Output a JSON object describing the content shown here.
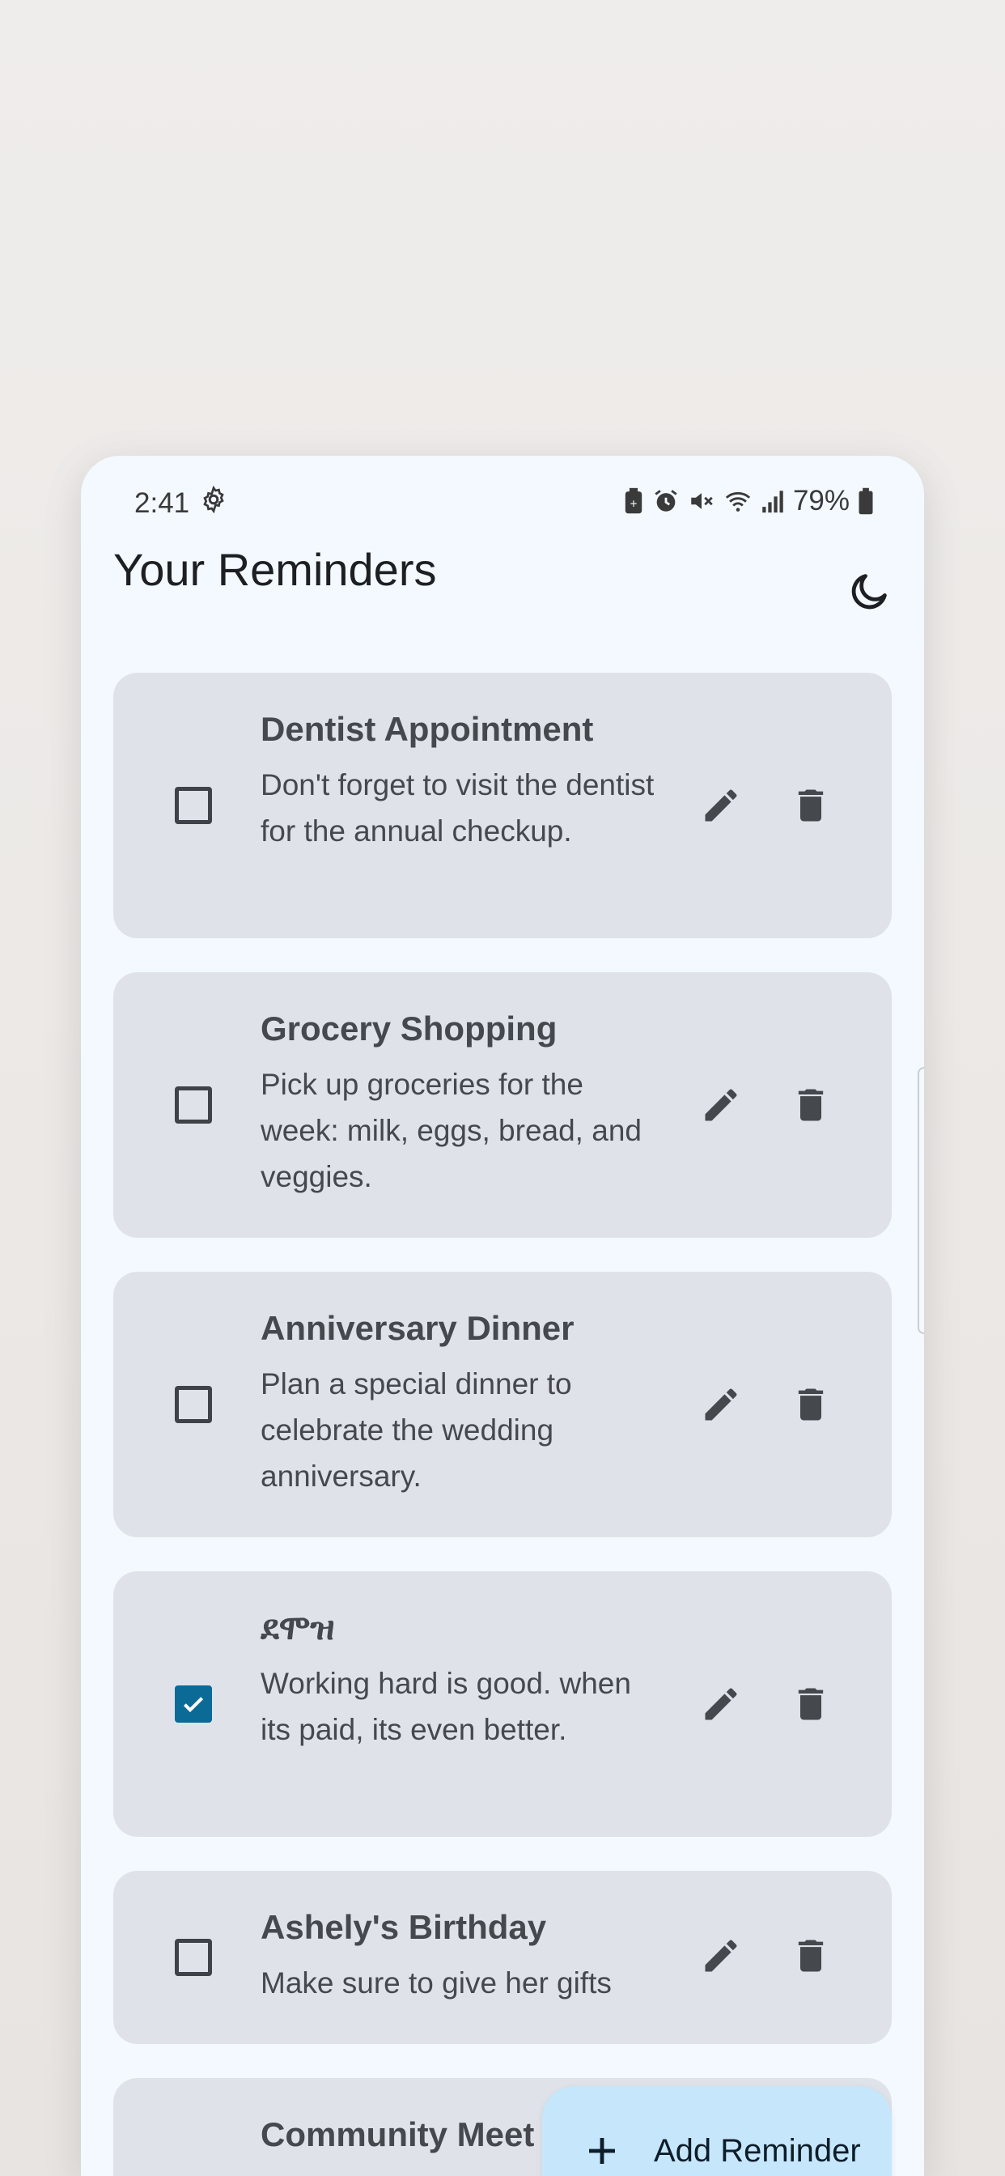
{
  "status_bar": {
    "time": "2:41",
    "battery": "79%",
    "icons": [
      "settings-icon",
      "battery-saver-icon",
      "alarm-icon",
      "mute-icon",
      "wifi-icon",
      "signal-icon",
      "battery-icon"
    ]
  },
  "header": {
    "title": "Your Reminders",
    "theme_toggle_icon": "moon-icon"
  },
  "reminders": [
    {
      "title": "Dentist Appointment",
      "description": "Don't forget to visit the dentist for the annual checkup.",
      "checked": false
    },
    {
      "title": "Grocery Shopping",
      "description": "Pick up groceries for the week: milk, eggs, bread, and veggies.",
      "checked": false
    },
    {
      "title": "Anniversary Dinner",
      "description": "Plan a special dinner to celebrate the wedding anniversary.",
      "checked": false
    },
    {
      "title": "ደሞዝ",
      "description": "Working hard is good. when its paid, its even better.",
      "checked": true
    },
    {
      "title": "Ashely's Birthday",
      "description": "Make sure to give her gifts",
      "checked": false
    },
    {
      "title": "Community Meet",
      "description": "",
      "checked": false
    }
  ],
  "fab": {
    "label": "Add Reminder",
    "icon": "plus-icon"
  },
  "colors": {
    "background": "#f3f9ff",
    "card": "#dfe3e9",
    "checked": "#0b6b96",
    "fab": "#c6e7fb",
    "text": "#45484d"
  }
}
